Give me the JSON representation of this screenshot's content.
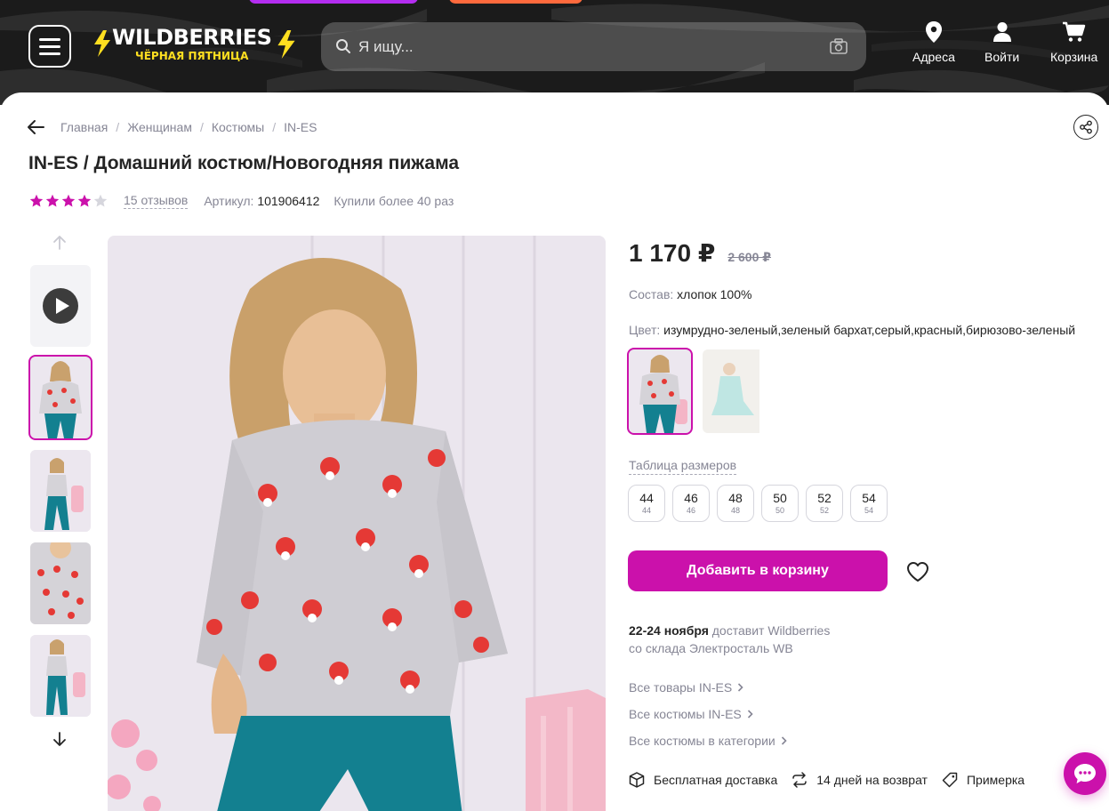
{
  "header": {
    "logo_text": "WILDBERRIES",
    "logo_sub": "ЧЁРНАЯ ПЯТНИЦА",
    "search_placeholder": "Я ищу...",
    "nav": [
      {
        "label": "Адреса",
        "icon": "location-pin-icon"
      },
      {
        "label": "Войти",
        "icon": "user-icon"
      },
      {
        "label": "Корзина",
        "icon": "cart-icon"
      }
    ]
  },
  "breadcrumb": [
    "Главная",
    "Женщинам",
    "Костюмы",
    "IN-ES"
  ],
  "product": {
    "title": "IN-ES / Домашний костюм/Новогодняя пижама",
    "rating": 4,
    "rating_max": 5,
    "reviews": "15 отзывов",
    "article_label": "Артикул:",
    "article": "101906412",
    "bought": "Купили более 40 раз"
  },
  "price": {
    "current": "1 170 ₽",
    "old": "2 600 ₽"
  },
  "composition": {
    "label": "Состав:",
    "value": "хлопок 100%"
  },
  "color": {
    "label": "Цвет:",
    "value": "изумрудно-зеленый,зеленый бархат,серый,красный,бирюзово-зеленый"
  },
  "size_table_label": "Таблица размеров",
  "sizes": [
    {
      "ru": "44",
      "orig": "44"
    },
    {
      "ru": "46",
      "orig": "46"
    },
    {
      "ru": "48",
      "orig": "48"
    },
    {
      "ru": "50",
      "orig": "50"
    },
    {
      "ru": "52",
      "orig": "52"
    },
    {
      "ru": "54",
      "orig": "54"
    }
  ],
  "add_to_cart": "Добавить в корзину",
  "delivery": {
    "date": "22-24 ноября",
    "by": "доставит Wildberries",
    "warehouse": "со склада Электросталь WB"
  },
  "links": [
    "Все товары IN-ES",
    "Все костюмы IN-ES",
    "Все костюмы в категории"
  ],
  "features": [
    {
      "label": "Бесплатная доставка",
      "icon": "box-icon"
    },
    {
      "label": "14 дней на возврат",
      "icon": "return-arrows-icon"
    },
    {
      "label": "Примерка",
      "icon": "tag-icon"
    }
  ],
  "colors": {
    "accent": "#cb11ab",
    "header_bg": "#1b1b1b",
    "text": "#242424",
    "muted": "#868695"
  }
}
